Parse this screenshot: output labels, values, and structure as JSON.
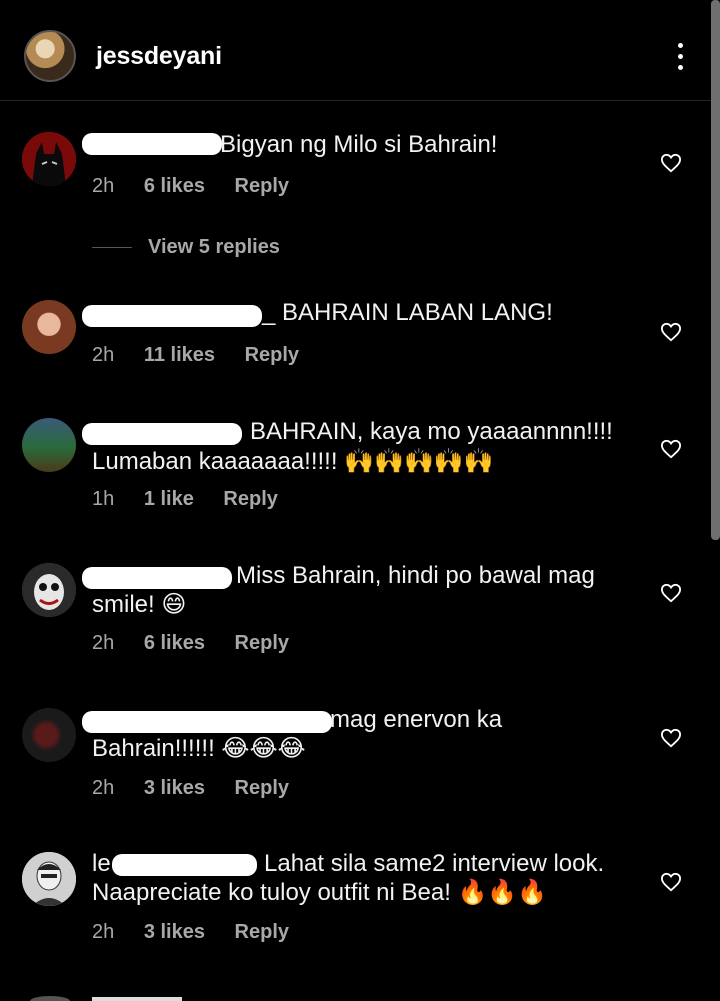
{
  "header": {
    "username": "jessdeyani"
  },
  "comments": [
    {
      "text": "Bigyan ng Milo si Bahrain!",
      "time": "2h",
      "likes": "6 likes",
      "reply": "Reply",
      "view_replies": "View 5 replies"
    },
    {
      "text": "_ BAHRAIN LABAN LANG!",
      "time": "2h",
      "likes": "11 likes",
      "reply": "Reply"
    },
    {
      "text": "BAHRAIN, kaya mo yaaaannnn!!!!",
      "text2": "Lumaban kaaaaaaa!!!!! 🙌🙌🙌🙌🙌",
      "time": "1h",
      "likes": "1 like",
      "reply": "Reply"
    },
    {
      "text": "Miss Bahrain, hindi po bawal mag",
      "text2": "smile! 😄",
      "time": "2h",
      "likes": "6 likes",
      "reply": "Reply"
    },
    {
      "text": "mag enervon ka",
      "text2": "Bahrain!!!!!! 😂😂😂",
      "time": "2h",
      "likes": "3 likes",
      "reply": "Reply"
    },
    {
      "prefix": "le",
      "text": "Lahat sila same2 interview look.",
      "text2": "Naapreciate ko tuloy outfit ni Bea! 🔥🔥🔥",
      "time": "2h",
      "likes": "3 likes",
      "reply": "Reply"
    }
  ]
}
